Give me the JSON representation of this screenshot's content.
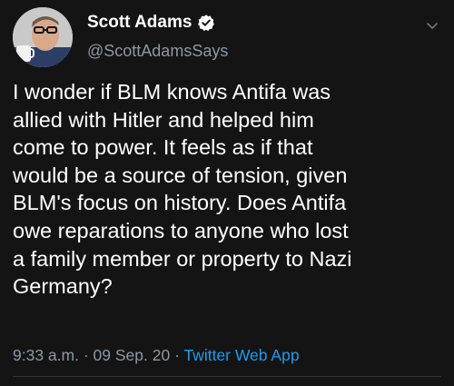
{
  "tweet": {
    "display_name": "Scott Adams",
    "handle": "@ScottAdamsSays",
    "verified": true,
    "text": "I wonder if BLM knows Antifa was\nallied with Hitler and helped him\ncome to power. It feels as if that\nwould be a source of tension, given\nBLM's focus on history. Does Antifa\nowe reparations to anyone who lost\na family member or property to Nazi\nGermany?",
    "time": "9:33 a.m.",
    "date": "09 Sep. 20",
    "separator": "·",
    "source_app": "Twitter Web App"
  },
  "icons": {
    "verified": "verified-badge-icon",
    "more": "chevron-down-icon",
    "avatar": "avatar"
  },
  "colors": {
    "background": "#141414",
    "text": "#ffffff",
    "secondary": "#8b98a5",
    "link": "#1d9bf0"
  }
}
